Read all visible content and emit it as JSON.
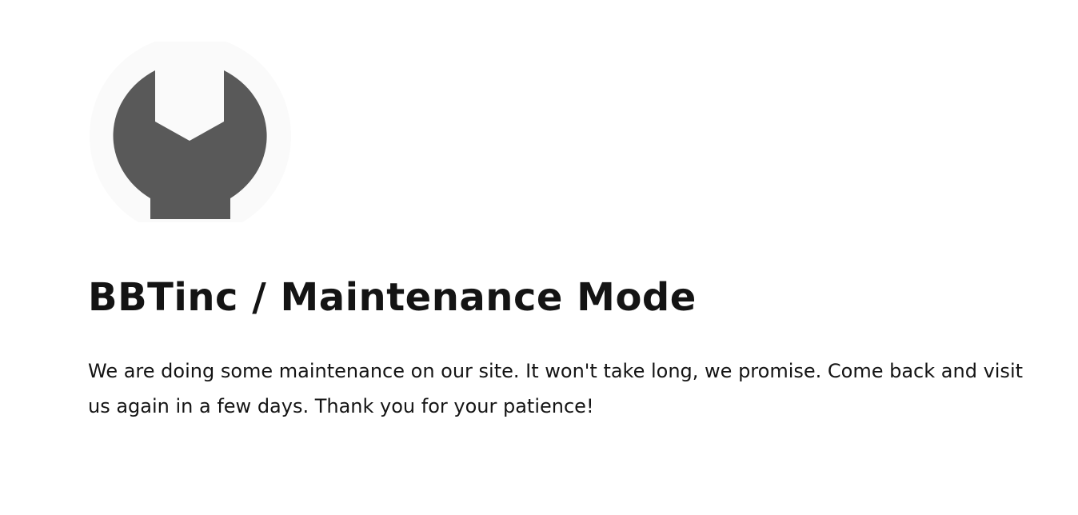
{
  "icon": {
    "name": "wrench-icon",
    "color": "#595959"
  },
  "header": {
    "title": "BBTinc / Maintenance Mode"
  },
  "main": {
    "message": "We are doing some maintenance on our site. It won't take long, we promise. Come back and visit us again in a few days. Thank you for your patience!"
  },
  "colors": {
    "text": "#141414",
    "background": "#ffffff"
  }
}
